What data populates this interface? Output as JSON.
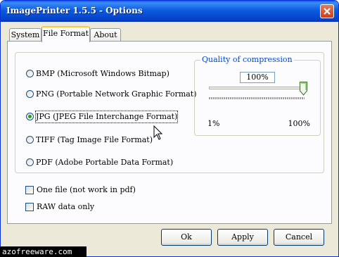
{
  "window": {
    "title": "ImagePrinter 1.5.5 - Options"
  },
  "tabs": [
    {
      "label": "System"
    },
    {
      "label": "File Format"
    },
    {
      "label": "About"
    }
  ],
  "formats": [
    {
      "label": "BMP   (Microsoft Windows Bitmap)",
      "selected": false
    },
    {
      "label": "PNG   (Portable Network Graphic Format)",
      "selected": false
    },
    {
      "label": "JPG   (JPEG File Interchange Format)",
      "selected": true
    },
    {
      "label": "TIFF   (Tag Image File Format)",
      "selected": false
    },
    {
      "label": "PDF   (Adobe Portable Data Format)",
      "selected": false
    }
  ],
  "compression": {
    "title": "Quality of compression",
    "value_text": "100%",
    "min_label": "1%",
    "max_label": "100%",
    "slider_fraction": 1.0
  },
  "options": {
    "one_file": "One file (not work in pdf)",
    "raw_data": "RAW data only"
  },
  "buttons": {
    "ok": "Ok",
    "apply": "Apply",
    "cancel": "Cancel"
  },
  "watermark": "azofreeware.com",
  "colors": {
    "titlebar": "#0a5be0",
    "accent_label": "#0046d5",
    "radio_dot": "#21a121",
    "close_button": "#c8401c"
  }
}
